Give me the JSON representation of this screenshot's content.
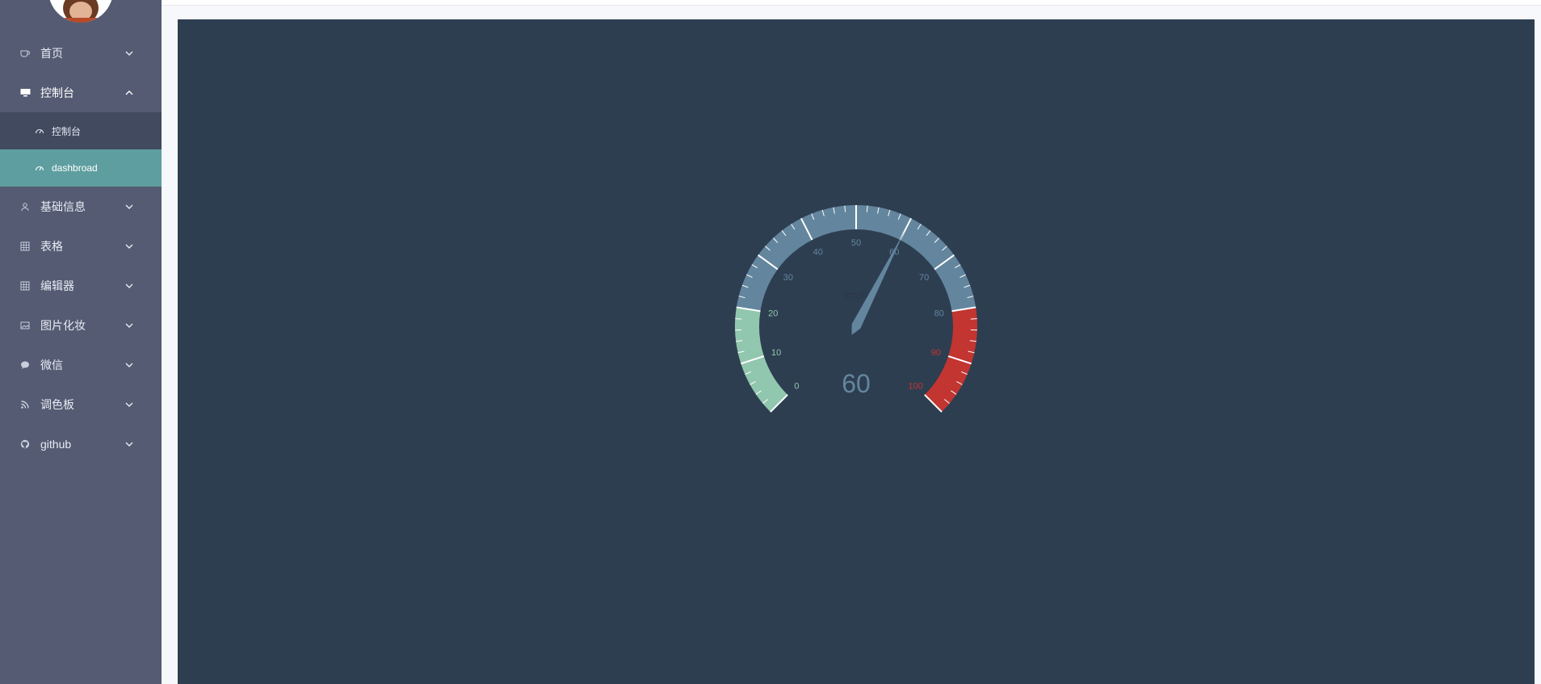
{
  "sidebar": {
    "items": [
      {
        "label": "首页",
        "icon": "coffee-cup-icon",
        "expanded": false
      },
      {
        "label": "控制台",
        "icon": "monitor-icon",
        "expanded": true,
        "children": [
          {
            "label": "控制台",
            "icon": "speedometer-icon",
            "active": false
          },
          {
            "label": "dashbroad",
            "icon": "speedometer-icon",
            "active": true
          }
        ]
      },
      {
        "label": "基础信息",
        "icon": "user-icon",
        "expanded": false
      },
      {
        "label": "表格",
        "icon": "grid-icon",
        "expanded": false
      },
      {
        "label": "编辑器",
        "icon": "grid-icon",
        "expanded": false
      },
      {
        "label": "图片化妆",
        "icon": "image-icon",
        "expanded": false
      },
      {
        "label": "微信",
        "icon": "chat-bubble-icon",
        "expanded": false
      },
      {
        "label": "调色板",
        "icon": "rss-icon",
        "expanded": false
      },
      {
        "label": "github",
        "icon": "github-icon",
        "expanded": false
      }
    ]
  },
  "colors": {
    "sidebar_bg": "#545b73",
    "active_item": "#5f9ea0",
    "panel_bg": "#2e3e51",
    "gauge_low": "#91c7ae",
    "gauge_mid": "#63869e",
    "gauge_high": "#c23531"
  },
  "chart_data": {
    "type": "gauge",
    "min": 0,
    "max": 100,
    "value": 60,
    "value_text": "60",
    "unit": "km/h",
    "axis_labels": [
      "0",
      "10",
      "20",
      "30",
      "40",
      "50",
      "60",
      "70",
      "80",
      "90",
      "100"
    ],
    "bands": [
      {
        "to": 20,
        "color": "#91c7ae"
      },
      {
        "to": 80,
        "color": "#63869e"
      },
      {
        "to": 100,
        "color": "#c23531"
      }
    ]
  }
}
